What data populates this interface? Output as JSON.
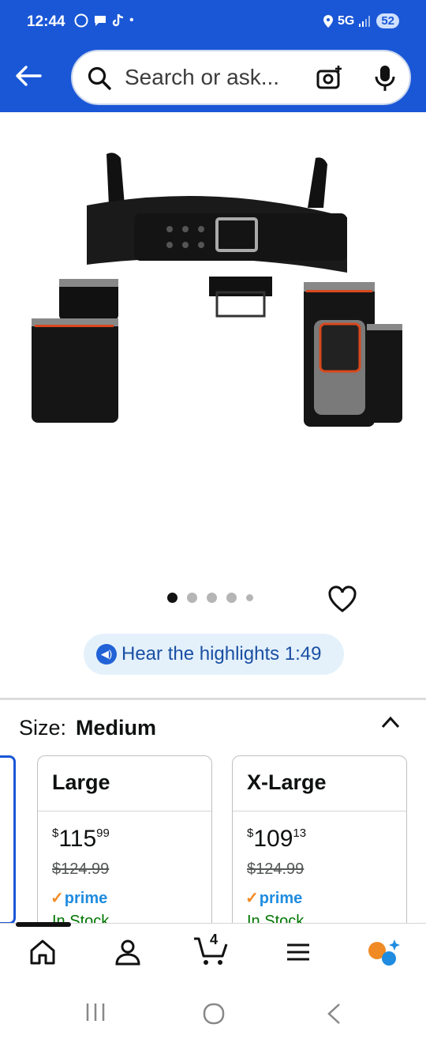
{
  "status_bar": {
    "time": "12:44",
    "network": "5G",
    "battery": "52"
  },
  "search": {
    "placeholder": "Search or ask..."
  },
  "carousel": {
    "dot_count": 5,
    "active_index": 0
  },
  "highlights": {
    "label": "Hear the highlights 1:49"
  },
  "size": {
    "label": "Size:",
    "selected": "Medium"
  },
  "size_options": [
    {
      "name": "Large",
      "price_whole": "115",
      "price_fraction": "99",
      "currency": "$",
      "list_price": "$124.99",
      "prime": "prime",
      "stock": "In Stock"
    },
    {
      "name": "X-Large",
      "price_whole": "109",
      "price_fraction": "13",
      "currency": "$",
      "list_price": "$124.99",
      "prime": "prime",
      "stock": "In Stock"
    }
  ],
  "bottom_nav": {
    "cart_count": "4"
  },
  "colors": {
    "header_blue": "#1a57d6",
    "prime_blue": "#1f8ce0",
    "prime_check": "#f08a24",
    "rufus_orange": "#f08a24"
  }
}
